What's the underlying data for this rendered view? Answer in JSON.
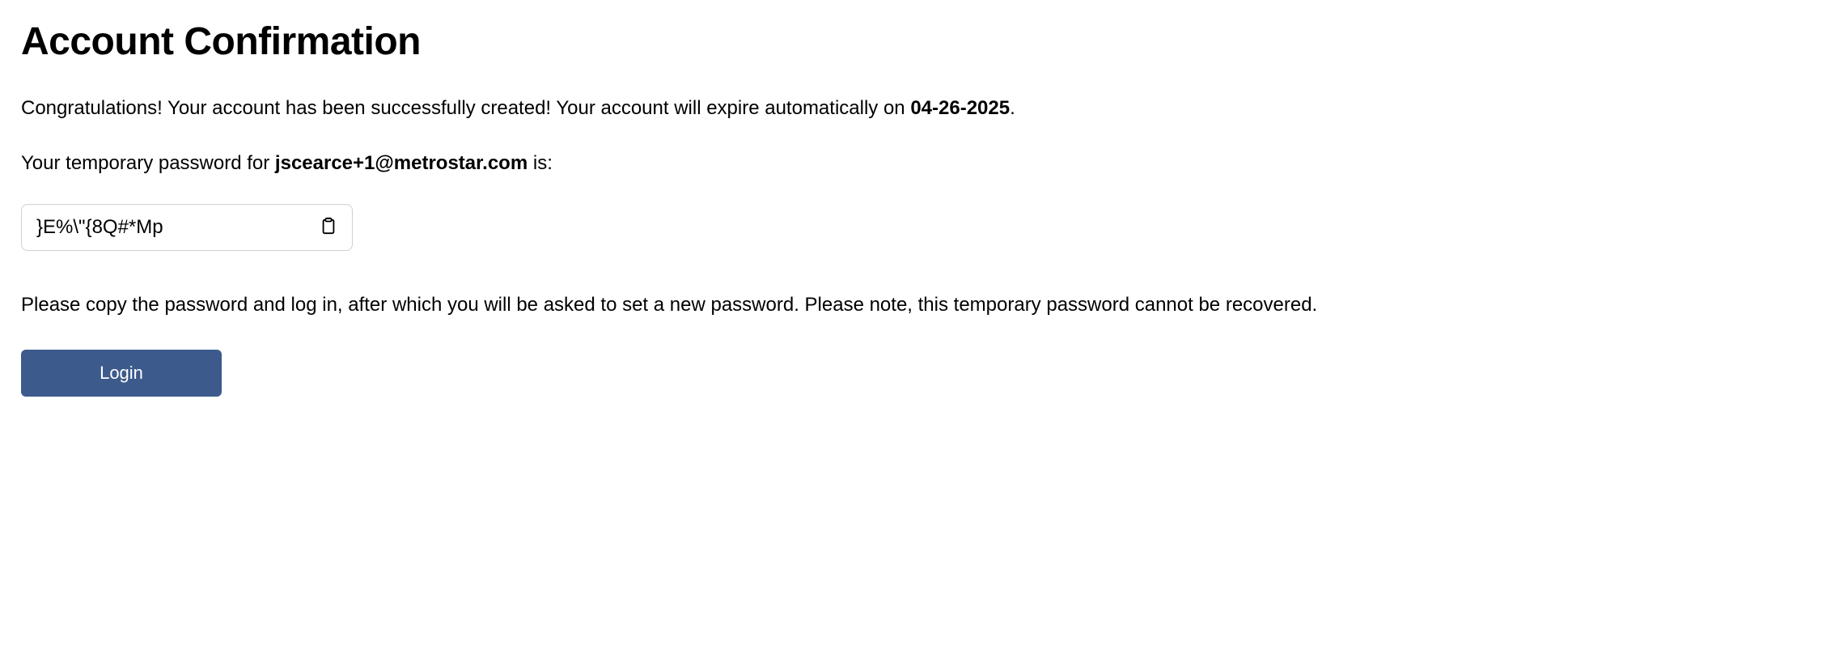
{
  "title": "Account Confirmation",
  "congrats_prefix": "Congratulations! Your account has been successfully created! Your account will expire automatically on ",
  "expiry_date": "04-26-2025",
  "congrats_suffix": ".",
  "temp_password_prefix": "Your temporary password for ",
  "email": "jscearce+1@metrostar.com",
  "temp_password_suffix": " is:",
  "temp_password": "}E%\\\"{8Q#*Mp",
  "instructions": "Please copy the password and log in, after which you will be asked to set a new password. Please note, this temporary password cannot be recovered.",
  "login_button_label": "Login"
}
